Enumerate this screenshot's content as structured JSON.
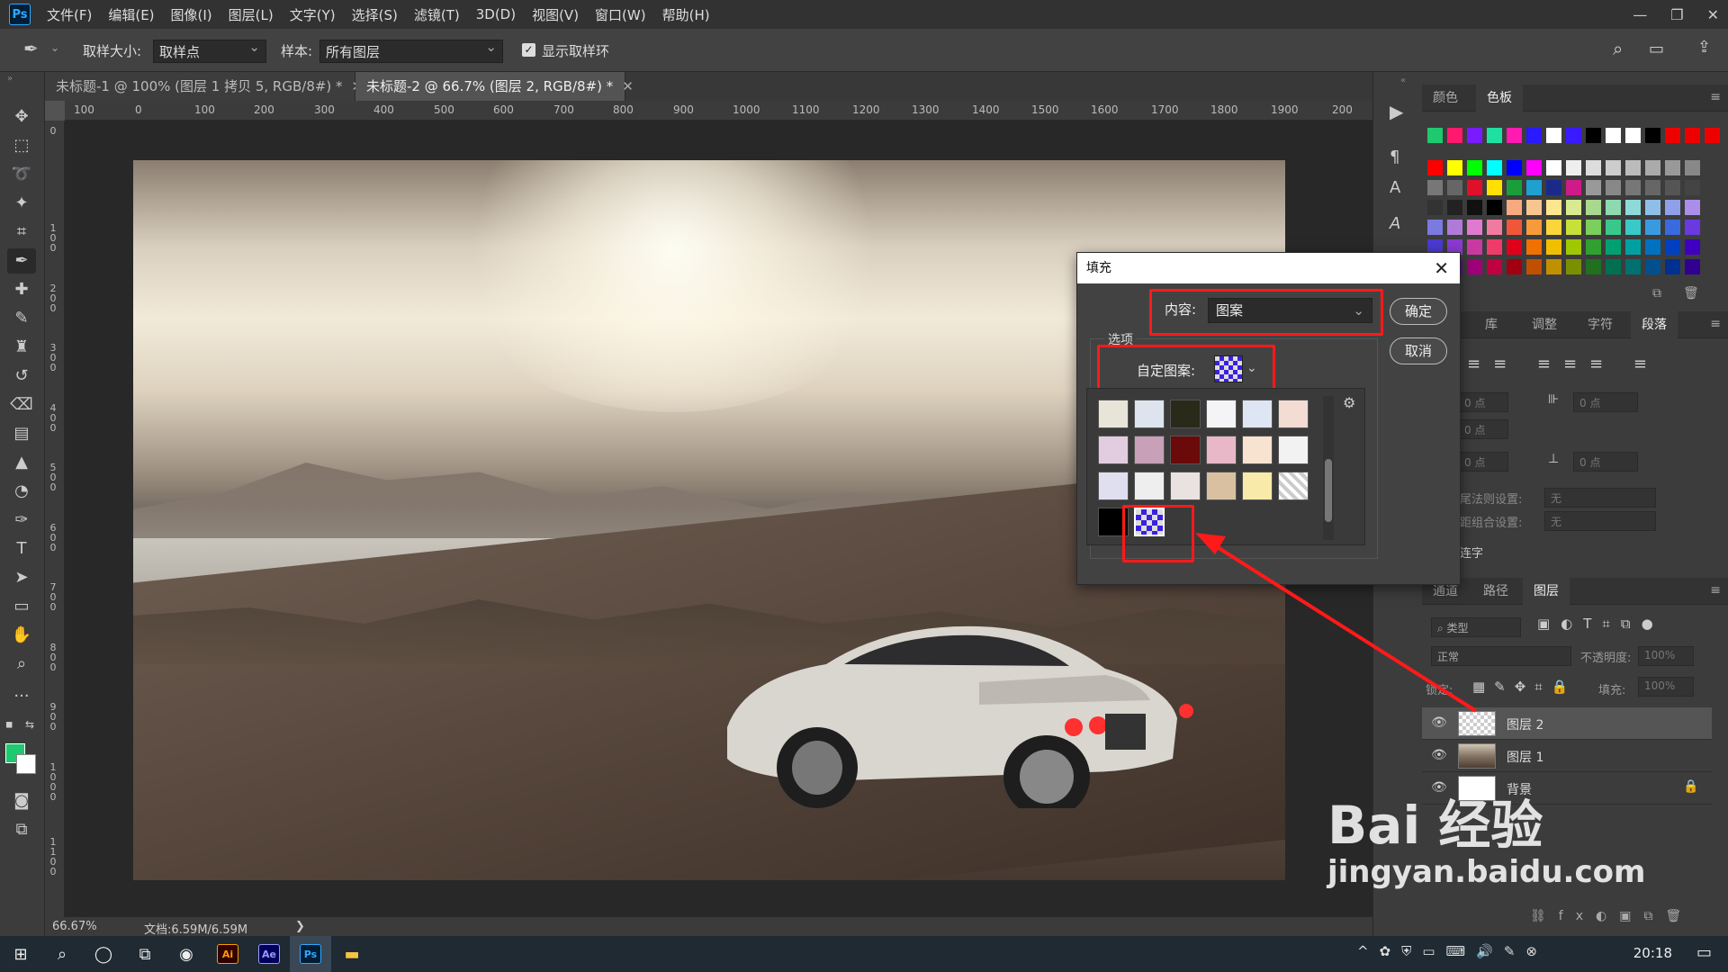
{
  "app": {
    "logo": "Ps"
  },
  "menu": [
    "文件(F)",
    "编辑(E)",
    "图像(I)",
    "图层(L)",
    "文字(Y)",
    "选择(S)",
    "滤镜(T)",
    "3D(D)",
    "视图(V)",
    "窗口(W)",
    "帮助(H)"
  ],
  "window_controls": {
    "minimize": "—",
    "restore": "❐",
    "close": "✕"
  },
  "options": {
    "sample_size_label": "取样大小:",
    "sample_size_value": "取样点",
    "sample_label": "样本:",
    "sample_value": "所有图层",
    "show_ring_label": "显示取样环",
    "show_ring_checked": true
  },
  "tabs": [
    {
      "label": "未标题-1 @ 100% (图层 1 拷贝 5, RGB/8#) *",
      "close": "✕"
    },
    {
      "label": "未标题-2 @ 66.7% (图层 2, RGB/8#) *",
      "close": "✕"
    }
  ],
  "ruler_h": [
    "100",
    "0",
    "100",
    "200",
    "300",
    "400",
    "500",
    "600",
    "700",
    "800",
    "900",
    "1000",
    "1100",
    "1200",
    "1300",
    "1400",
    "1500",
    "1600",
    "1700",
    "1800",
    "1900",
    "200"
  ],
  "ruler_v": [
    "0",
    "1 0 0",
    "2 0 0",
    "3 0 0",
    "4 0 0",
    "5 0 0",
    "6 0 0",
    "7 0 0",
    "8 0 0",
    "9 0 0",
    "1 0 0 0",
    "1 1 0 0"
  ],
  "status": {
    "zoom": "66.67%",
    "doc": "文档:6.59M/6.59M",
    "arrow": "❯"
  },
  "colors": {
    "foreground": "#1ec96f",
    "background": "#ffffff",
    "accent_red": "#ff1a1a"
  },
  "swatches_panel": {
    "tabs": [
      "颜色",
      "色板"
    ],
    "active": "色板"
  },
  "paragraph_panel": {
    "tabs": [
      "库",
      "调整",
      "字符",
      "段落"
    ],
    "active": "段落",
    "inputs": [
      "0 点",
      "0 点",
      "0 点",
      "0 点",
      "0 点"
    ],
    "hyphen_label": "尾法则设置:",
    "hyphen_value": "无",
    "compose_label": "距组合设置:",
    "compose_value": "无",
    "auto_label": "连字"
  },
  "layers_panel": {
    "tabs": [
      "通道",
      "路径",
      "图层"
    ],
    "active": "图层",
    "filter_label": "类型",
    "blend_mode": "正常",
    "opacity_label": "不透明度:",
    "opacity_value": "100%",
    "lock_label": "锁定:",
    "fill_label": "填充:",
    "fill_value": "100%",
    "layers": [
      {
        "name": "图层 2",
        "selected": true
      },
      {
        "name": "图层 1",
        "selected": false
      },
      {
        "name": "背景",
        "selected": false,
        "locked": true
      }
    ]
  },
  "dialog": {
    "title": "填充",
    "close": "✕",
    "content_label": "内容:",
    "content_value": "图案",
    "ok": "确定",
    "cancel": "取消",
    "options_label": "选项",
    "custom_pattern_label": "自定图案:"
  },
  "taskbar": {
    "time": "20:18",
    "apps": [
      "Ai",
      "Ae",
      "Ps"
    ]
  },
  "watermark": {
    "brand": "Bai  经验",
    "url": "jingyan.baidu.com"
  }
}
